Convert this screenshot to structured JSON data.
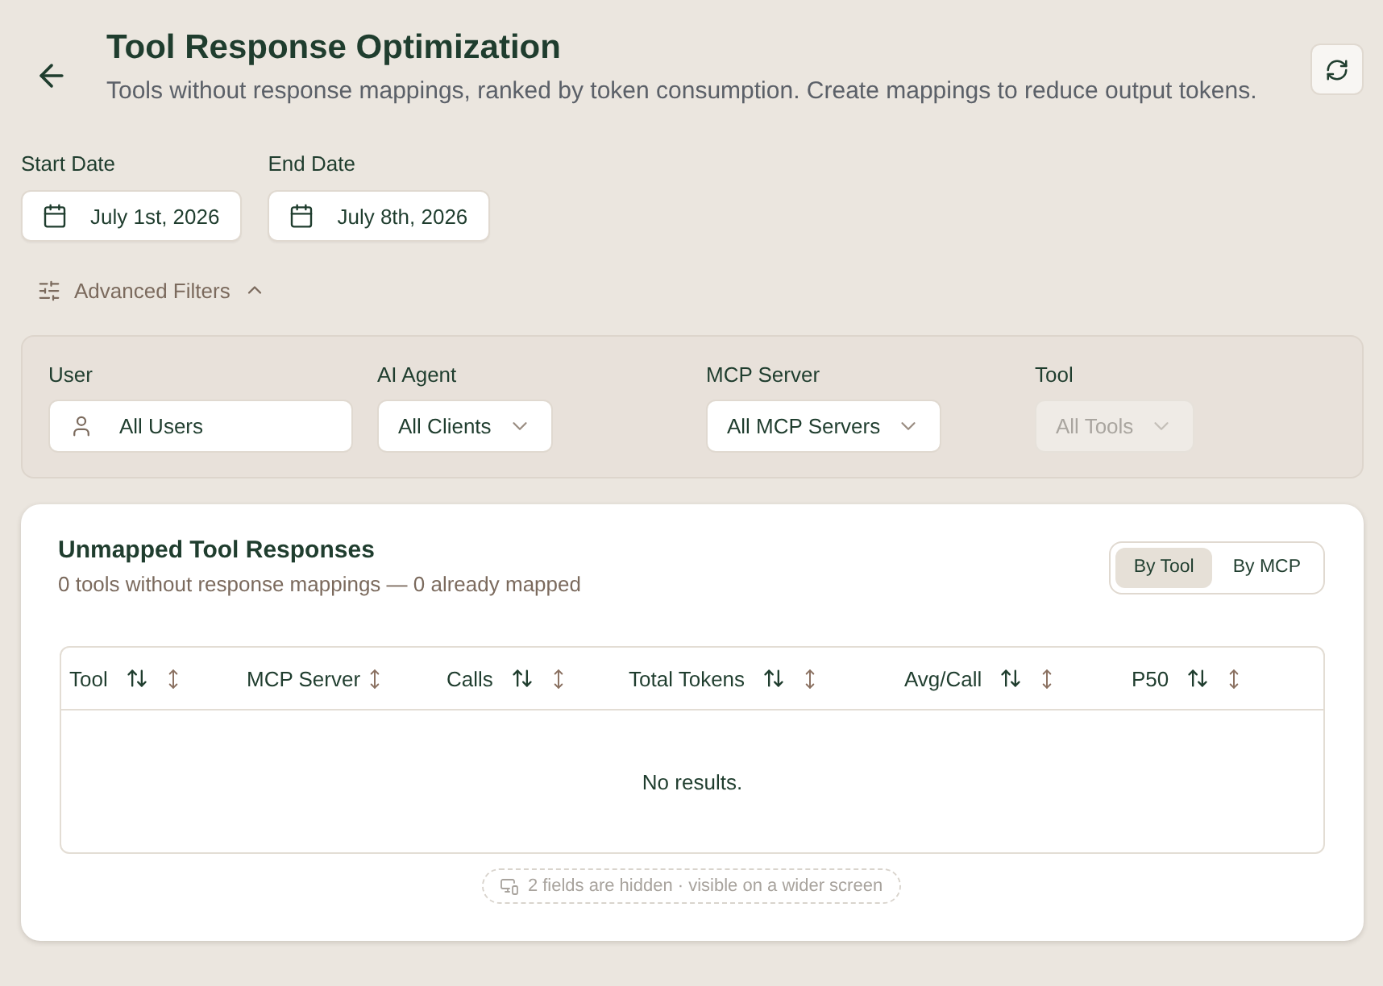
{
  "header": {
    "title": "Tool Response Optimization",
    "subtitle": "Tools without response mappings, ranked by token consumption. Create mappings to reduce output tokens."
  },
  "date_range": [
    {
      "label": "Start Date",
      "value": "July 1st, 2026"
    },
    {
      "label": "End Date",
      "value": "July 8th, 2026"
    }
  ],
  "advanced_filters": {
    "label": "Advanced Filters",
    "expanded": true,
    "filters": [
      {
        "label": "User",
        "kind": "user",
        "value": "All Users",
        "disabled": false
      },
      {
        "label": "AI Agent",
        "kind": "select",
        "value": "All Clients",
        "disabled": false
      },
      {
        "label": "MCP Server",
        "kind": "select",
        "value": "All MCP Servers",
        "disabled": false
      },
      {
        "label": "Tool",
        "kind": "select",
        "value": "All Tools",
        "disabled": true
      }
    ]
  },
  "card": {
    "title": "Unmapped Tool Responses",
    "subtitle": "0 tools without response mappings — 0 already mapped",
    "view_toggle": [
      {
        "label": "By Tool",
        "selected": true
      },
      {
        "label": "By MCP",
        "selected": false
      }
    ],
    "table": {
      "columns": [
        {
          "label": "Tool",
          "kind": "sortable"
        },
        {
          "label": "MCP Server",
          "kind": "plain"
        },
        {
          "label": "Calls",
          "kind": "sortable"
        },
        {
          "label": "Total Tokens",
          "kind": "sortable"
        },
        {
          "label": "Avg/Call",
          "kind": "sortable"
        },
        {
          "label": "P50",
          "kind": "sortable"
        }
      ],
      "empty_message": "No results."
    },
    "hidden_fields_note": "2 fields are hidden · visible on a wider screen"
  }
}
